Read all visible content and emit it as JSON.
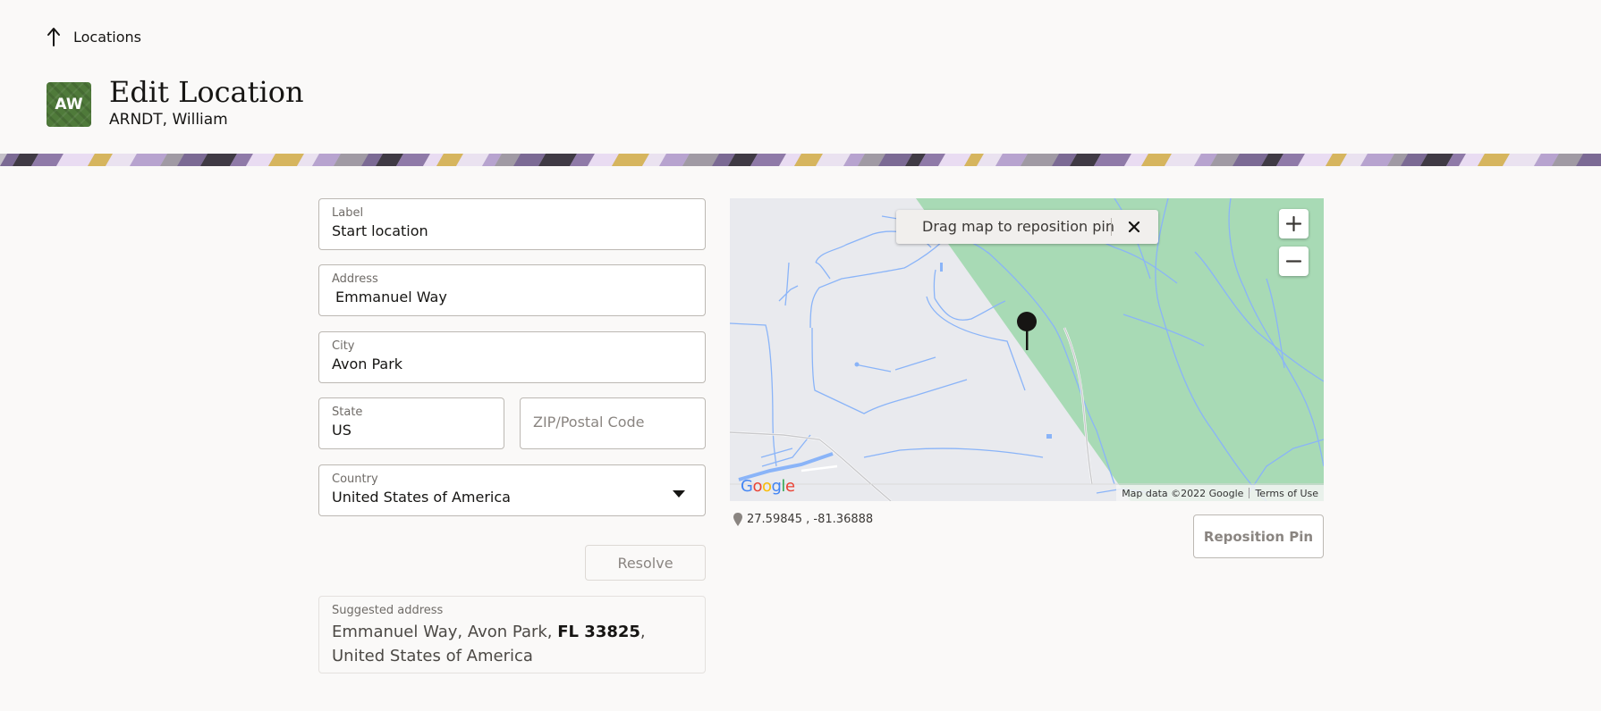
{
  "header": {
    "back_link_label": "Locations",
    "avatar_initials": "AW",
    "title": "Edit Location",
    "subtitle": "ARNDT, William"
  },
  "form": {
    "label": {
      "label": "Label",
      "value": "Start location"
    },
    "address": {
      "label": "Address",
      "value": "Emmanuel Way"
    },
    "city": {
      "label": "City",
      "value": "Avon Park"
    },
    "state": {
      "label": "State",
      "value": "US"
    },
    "zip": {
      "placeholder": "ZIP/Postal Code"
    },
    "country": {
      "label": "Country",
      "value": "United States of America"
    },
    "resolve_label": "Resolve",
    "suggested": {
      "label": "Suggested address",
      "part1": "Emmanuel Way, Avon Park, ",
      "bold": "FL 33825",
      "part2": ", United States of America"
    }
  },
  "map": {
    "toast_text": "Drag map to reposition pin",
    "map_data_label": "Map data ©2022 Google",
    "terms_label": "Terms of Use",
    "coordinates": "27.59845 , -81.36888",
    "reposition_label": "Reposition Pin"
  },
  "colors": {
    "page_bg": "#faf9f8",
    "avatar_bg": "#4f7a3a",
    "map_green": "#a8dab5",
    "map_water": "#8ab4f8"
  },
  "icons": {
    "back": "up-arrow-icon",
    "close": "close-icon",
    "zoom_in": "plus-icon",
    "zoom_out": "minus-icon",
    "pin": "map-pin-icon",
    "dropdown": "chevron-down-icon"
  }
}
